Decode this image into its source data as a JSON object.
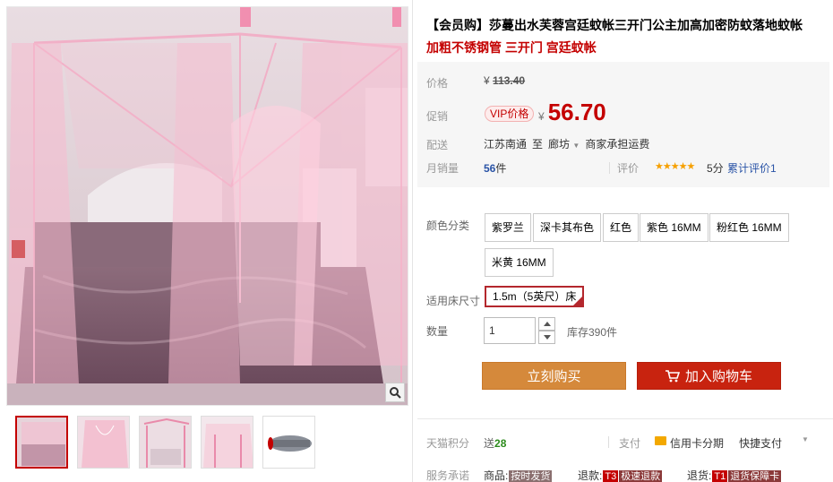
{
  "product": {
    "title": "【会员购】莎蔓出水芙蓉宫廷蚊帐三开门公主加高加密防蚊落地蚊帐",
    "subtitle": "加粗不锈钢管 三开门 宫廷蚊帐"
  },
  "price": {
    "label": "价格",
    "currency": "¥",
    "original": "113.40",
    "promo_label": "促销",
    "vip_tag": "VIP价格",
    "promo": "56.70"
  },
  "shipping": {
    "label": "配送",
    "origin": "江苏南通",
    "to": "至",
    "destination": "廊坊",
    "fee": "商家承担运费"
  },
  "sales": {
    "label": "月销量",
    "count": "56",
    "unit": "件",
    "rating_label": "评价",
    "stars": "★★★★★",
    "score": "5分",
    "reviews": "累计评价1"
  },
  "sku": {
    "color_label": "颜色分类",
    "colors": [
      "紫罗兰",
      "深卡其布色",
      "红色",
      "紫色 16MM",
      "粉红色 16MM",
      "米黄 16MM"
    ],
    "size_label": "适用床尺寸",
    "size_selected": "1.5m（5英尺）床",
    "qty_label": "数量",
    "qty_value": "1",
    "stock": "库存390件"
  },
  "actions": {
    "buy": "立刻购买",
    "cart": "加入购物车"
  },
  "extras": {
    "points_label": "天猫积分",
    "points_prefix": "送",
    "points": "28",
    "pay_label": "支付",
    "pay_credit": "信用卡分期",
    "pay_quick": "快捷支付",
    "service_label": "服务承诺",
    "svc1_prefix": "商品:",
    "svc1_tag": "按时发货",
    "svc2_prefix": "退款:",
    "svc2_code": "T3",
    "svc2_tag": "极速退款",
    "svc3_prefix": "退货:",
    "svc3_code": "T1",
    "svc3_tag": "退货保障卡"
  },
  "icons": {
    "zoom": "magnifier-icon",
    "cart": "cart-icon",
    "credit": "credit-card-icon"
  },
  "colors": {
    "accent_red": "#c40000",
    "buy_orange": "#d5893b",
    "cart_red": "#c8230f",
    "link_blue": "#2953a6"
  }
}
